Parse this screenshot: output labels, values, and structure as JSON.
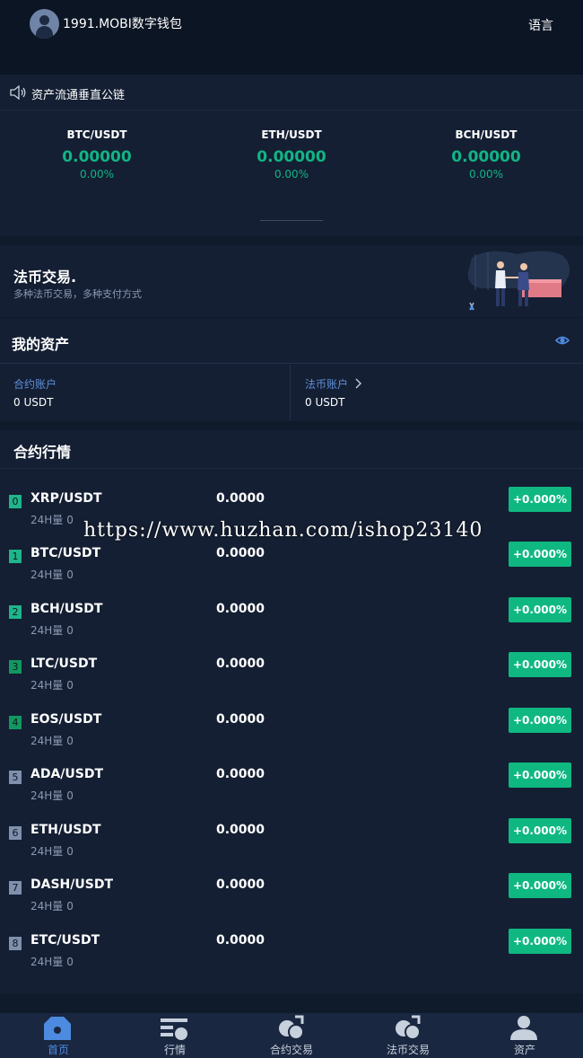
{
  "header": {
    "app_title": "1991.MOBI数字钱包",
    "language_label": "语言"
  },
  "notice": {
    "text": "资产流通垂直公链"
  },
  "tickers": [
    {
      "pair": "BTC/USDT",
      "price": "0.00000",
      "change": "0.00%"
    },
    {
      "pair": "ETH/USDT",
      "price": "0.00000",
      "change": "0.00%"
    },
    {
      "pair": "BCH/USDT",
      "price": "0.00000",
      "change": "0.00%"
    }
  ],
  "fiat_promo": {
    "title": "法币交易.",
    "subtitle": "多种法币交易，多种支付方式"
  },
  "assets": {
    "title": "我的资产",
    "contract_account": {
      "label": "合约账户",
      "value": "0 USDT"
    },
    "fiat_account": {
      "label": "法币账户",
      "value": "0 USDT"
    }
  },
  "market": {
    "title": "合约行情",
    "volume_label": "24H量",
    "rows": [
      {
        "rank": "0",
        "symbol": "XRP/USDT",
        "volume": "0",
        "price": "0.0000",
        "change": "+0.000%",
        "rank_color": "#1fb589"
      },
      {
        "rank": "1",
        "symbol": "BTC/USDT",
        "volume": "0",
        "price": "0.0000",
        "change": "+0.000%",
        "rank_color": "#1fb589"
      },
      {
        "rank": "2",
        "symbol": "BCH/USDT",
        "volume": "0",
        "price": "0.0000",
        "change": "+0.000%",
        "rank_color": "#1fb589"
      },
      {
        "rank": "3",
        "symbol": "LTC/USDT",
        "volume": "0",
        "price": "0.0000",
        "change": "+0.000%",
        "rank_color": "#11995f"
      },
      {
        "rank": "4",
        "symbol": "EOS/USDT",
        "volume": "0",
        "price": "0.0000",
        "change": "+0.000%",
        "rank_color": "#11995f"
      },
      {
        "rank": "5",
        "symbol": "ADA/USDT",
        "volume": "0",
        "price": "0.0000",
        "change": "+0.000%",
        "rank_color": "#7f90ad"
      },
      {
        "rank": "6",
        "symbol": "ETH/USDT",
        "volume": "0",
        "price": "0.0000",
        "change": "+0.000%",
        "rank_color": "#7f90ad"
      },
      {
        "rank": "7",
        "symbol": "DASH/USDT",
        "volume": "0",
        "price": "0.0000",
        "change": "+0.000%",
        "rank_color": "#7f90ad"
      },
      {
        "rank": "8",
        "symbol": "ETC/USDT",
        "volume": "0",
        "price": "0.0000",
        "change": "+0.000%",
        "rank_color": "#7f90ad"
      }
    ]
  },
  "watermark": "https://www.huzhan.com/ishop23140",
  "tabbar": {
    "items": [
      {
        "label": "首页",
        "icon": "home-icon"
      },
      {
        "label": "行情",
        "icon": "market-icon"
      },
      {
        "label": "合约交易",
        "icon": "contract-icon"
      },
      {
        "label": "法币交易",
        "icon": "fiat-icon"
      },
      {
        "label": "资产",
        "icon": "user-icon"
      }
    ]
  },
  "colors": {
    "background": "#0f1a2b",
    "card": "#141f33",
    "positive": "#11b585",
    "accent": "#4d8be0"
  }
}
